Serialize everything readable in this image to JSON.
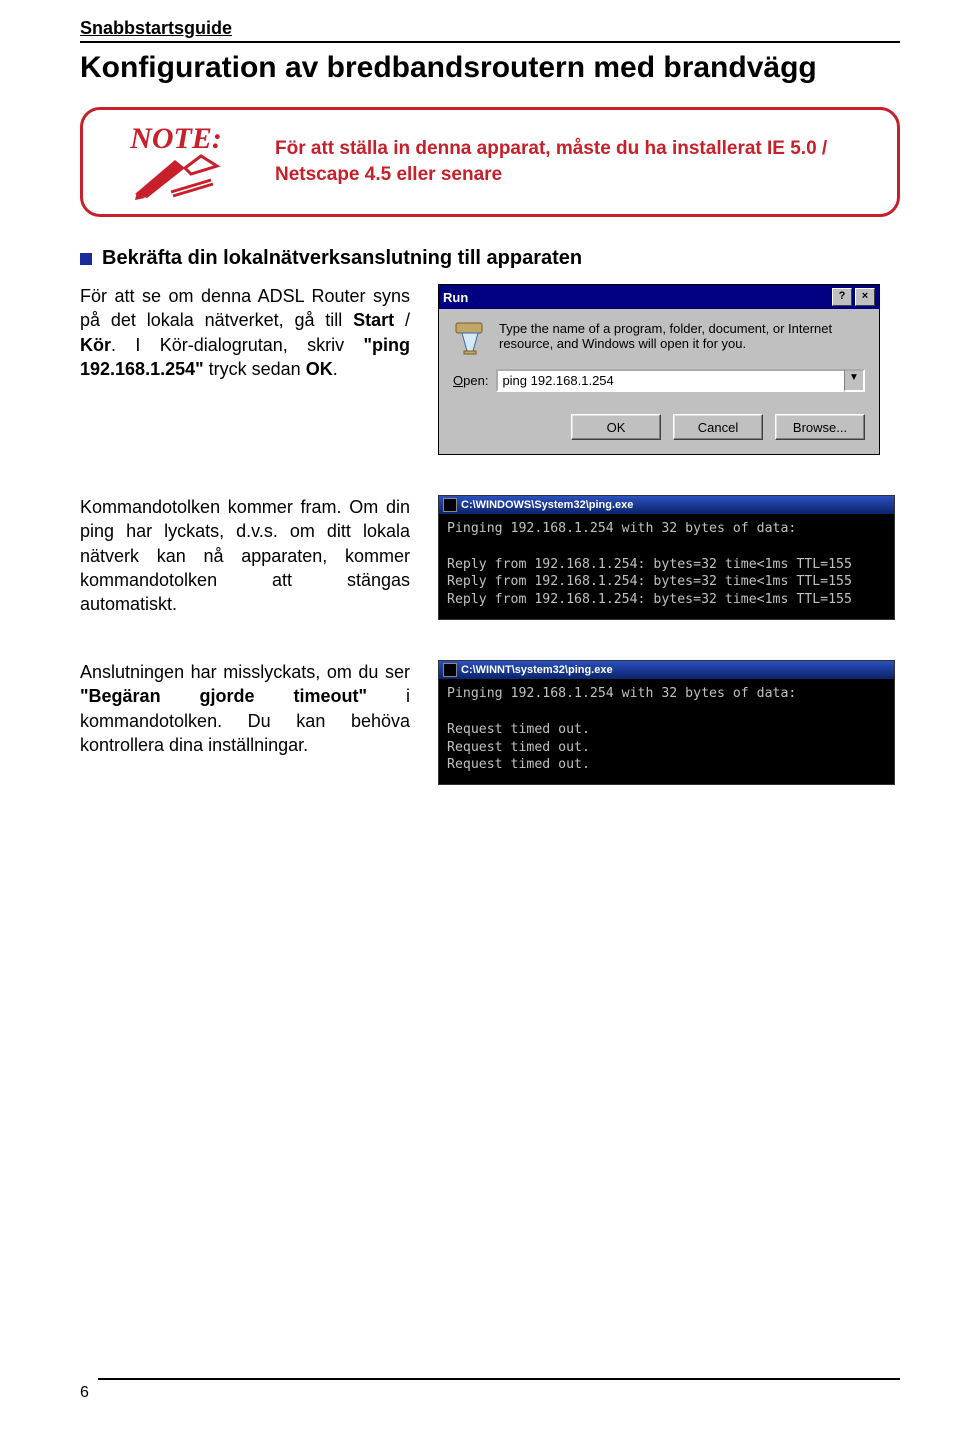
{
  "header": {
    "label": "Snabbstartsguide"
  },
  "title": "Konfiguration av bredbandsroutern med brandvägg",
  "note": {
    "label": "NOTE:",
    "text": "För att ställa in denna apparat, måste du ha installerat IE 5.0 / Netscape 4.5 eller senare"
  },
  "section1": {
    "title": "Bekräfta din lokalnätverksanslutning till apparaten"
  },
  "run_para": {
    "pre1": "För att se om denna ADSL Router syns på det lokala nätverket, gå till ",
    "b1": "Start",
    "mid1": " / ",
    "b2": "Kör",
    "post1": ". I Kör-dialogrutan, skriv ",
    "b3": "\"ping 192.168.1.254\"",
    "post2": " tryck sedan ",
    "b4": "OK",
    "post3": "."
  },
  "run_dialog": {
    "title": "Run",
    "help": "?",
    "close": "×",
    "desc": "Type the name of a program, folder, document, or Internet resource, and Windows will open it for you.",
    "open_label_html": "Open:",
    "open_u": "O",
    "open_rest": "pen:",
    "input_value": "ping 192.168.1.254",
    "ok": "OK",
    "cancel": "Cancel",
    "browse": "Browse..."
  },
  "cmd1_para": "Kommandotolken kommer fram. Om din ping har lyckats, d.v.s. om ditt lokala nätverk kan nå apparaten, kommer kommandotolken att stängas automatiskt.",
  "cmd1": {
    "title": "C:\\WINDOWS\\System32\\ping.exe",
    "body": "Pinging 192.168.1.254 with 32 bytes of data:\n\nReply from 192.168.1.254: bytes=32 time<1ms TTL=155\nReply from 192.168.1.254: bytes=32 time<1ms TTL=155\nReply from 192.168.1.254: bytes=32 time<1ms TTL=155"
  },
  "cmd2_para": {
    "pre": "Anslutningen har misslyckats, om du ser ",
    "b1": "\"Begäran gjorde timeout\"",
    "post": " i kommandotolken. Du kan behöva kontrollera dina inställningar."
  },
  "cmd2": {
    "title": "C:\\WINNT\\system32\\ping.exe",
    "body": "Pinging 192.168.1.254 with 32 bytes of data:\n\nRequest timed out.\nRequest timed out.\nRequest timed out."
  },
  "page_number": "6"
}
